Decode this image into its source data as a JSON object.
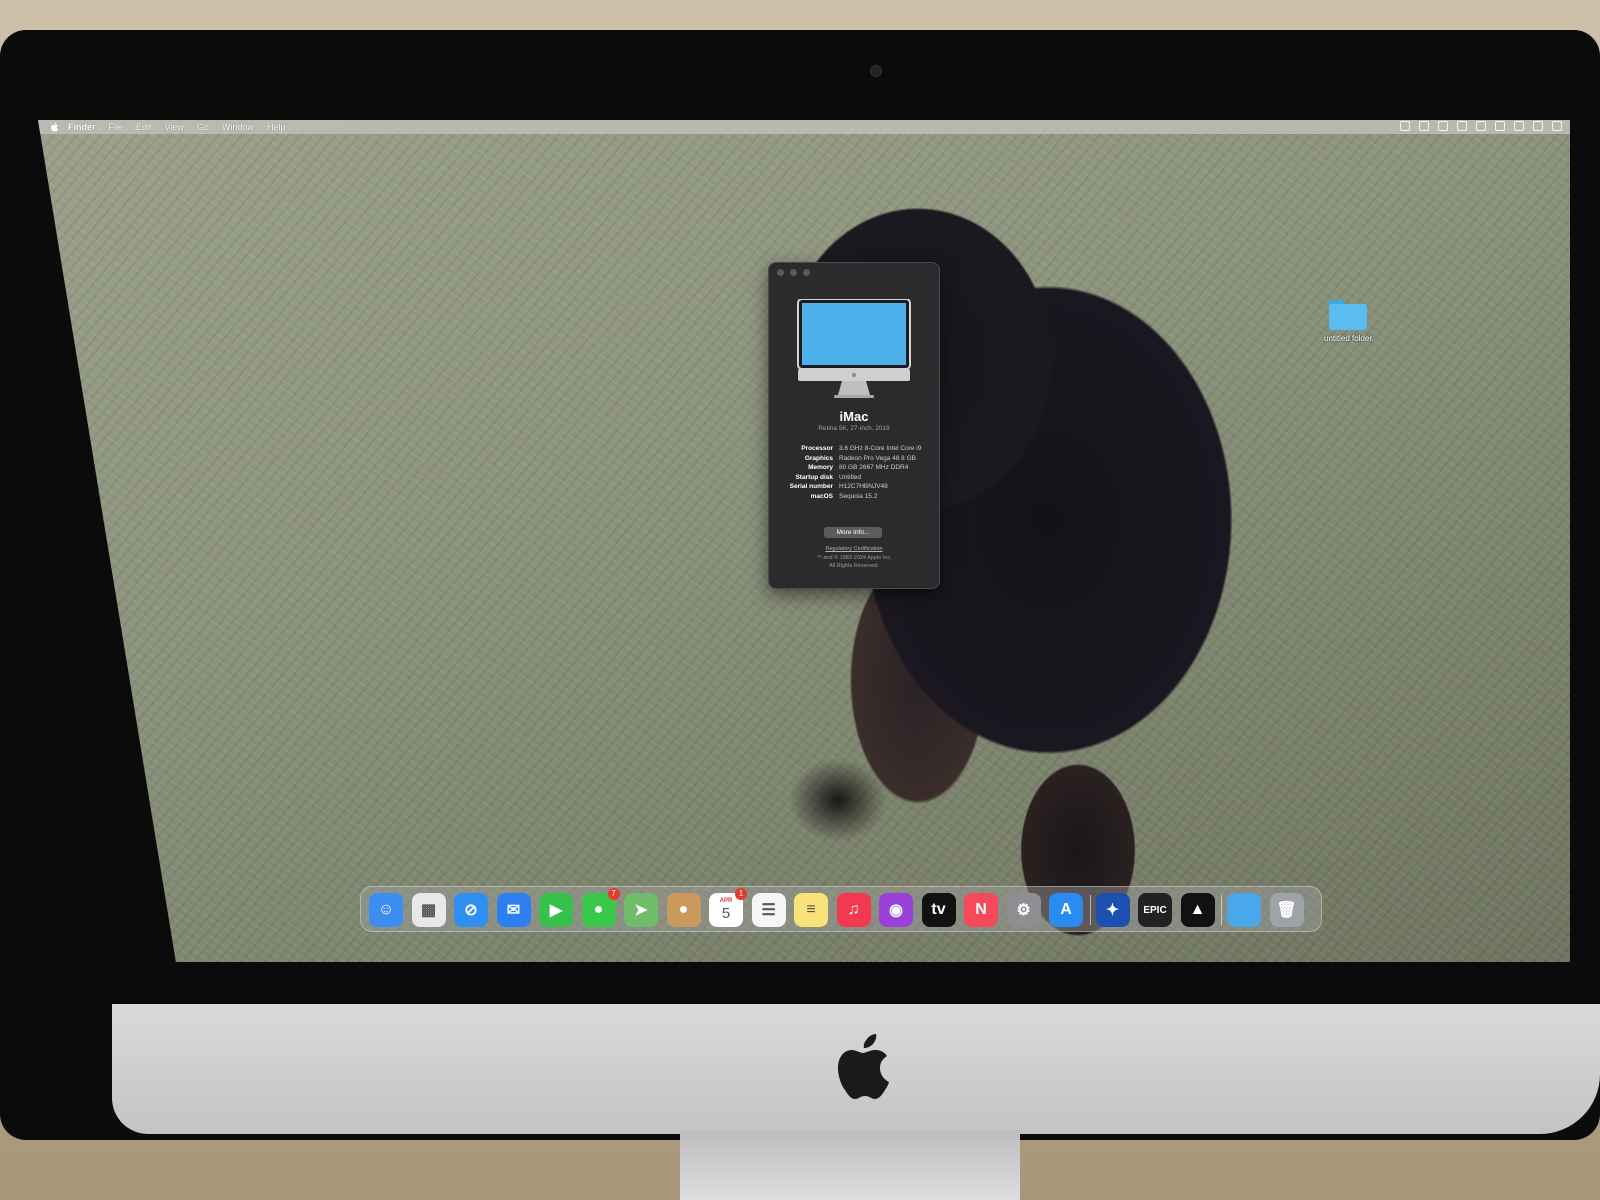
{
  "menubar": {
    "app_name": "Finder",
    "items": [
      "File",
      "Edit",
      "View",
      "Go",
      "Window",
      "Help"
    ],
    "status_icons": [
      "bluetooth-icon",
      "battery-icon",
      "display-icon",
      "volume-icon",
      "wifi-icon",
      "user-icon",
      "spotlight-icon",
      "control-center-icon",
      "siri-icon"
    ]
  },
  "desktop": {
    "folder_label": "untitled folder"
  },
  "about_window": {
    "model": "iMac",
    "subtitle": "Retina 5K, 27-inch, 2019",
    "specs": [
      {
        "key": "Processor",
        "value": "3.6 GHz 8-Core Intel Core i9"
      },
      {
        "key": "Graphics",
        "value": "Radeon Pro Vega 48 8 GB"
      },
      {
        "key": "Memory",
        "value": "80 GB 2667 MHz DDR4"
      },
      {
        "key": "Startup disk",
        "value": "Untitled"
      },
      {
        "key": "Serial number",
        "value": "H12C7HBNJV48"
      },
      {
        "key": "macOS",
        "value": "Sequoia 15.2"
      }
    ],
    "more_info_button": "More Info...",
    "regulatory_link": "Regulatory Certification",
    "copyright_line1": "™ and © 1983-2024 Apple Inc.",
    "copyright_line2": "All Rights Reserved."
  },
  "dock": {
    "apps": [
      {
        "name": "Finder",
        "icon": "finder-icon",
        "color": "#3b8ef0",
        "glyph": "☺"
      },
      {
        "name": "Launchpad",
        "icon": "launchpad-icon",
        "color": "#e8e8ea",
        "glyph": "▦"
      },
      {
        "name": "Safari",
        "icon": "safari-icon",
        "color": "#2f8ef2",
        "glyph": "⊘"
      },
      {
        "name": "Mail",
        "icon": "mail-icon",
        "color": "#2c7ff0",
        "glyph": "✉"
      },
      {
        "name": "FaceTime",
        "icon": "facetime-icon",
        "color": "#37c14a",
        "glyph": "▶"
      },
      {
        "name": "Messages",
        "icon": "messages-icon",
        "color": "#39c84a",
        "glyph": "●",
        "badge": "7"
      },
      {
        "name": "Maps",
        "icon": "maps-icon",
        "color": "#6fbd6a",
        "glyph": "➤"
      },
      {
        "name": "Contacts",
        "icon": "contacts-icon",
        "color": "#c99a5c",
        "glyph": "●"
      },
      {
        "name": "Calendar",
        "icon": "calendar-icon",
        "color": "#ffffff",
        "glyph": "5",
        "month": "APR",
        "badge": "1"
      },
      {
        "name": "Reminders",
        "icon": "reminders-icon",
        "color": "#f5f5f7",
        "glyph": "☰"
      },
      {
        "name": "Notes",
        "icon": "notes-icon",
        "color": "#f8e27a",
        "glyph": "≡"
      },
      {
        "name": "Music",
        "icon": "music-icon",
        "color": "#f3394f",
        "glyph": "♫"
      },
      {
        "name": "Podcasts",
        "icon": "podcasts-icon",
        "color": "#9a42d8",
        "glyph": "◉"
      },
      {
        "name": "TV",
        "icon": "appletv-icon",
        "color": "#111111",
        "glyph": "tv"
      },
      {
        "name": "News",
        "icon": "news-icon",
        "color": "#f64a5a",
        "glyph": "N"
      },
      {
        "name": "System Settings",
        "icon": "system-settings-icon",
        "color": "#8e8e93",
        "glyph": "⚙"
      },
      {
        "name": "App Store",
        "icon": "app-store-icon",
        "color": "#2a8cf3",
        "glyph": "A"
      },
      {
        "name": "Battle.net",
        "icon": "battlenet-icon",
        "color": "#1c4fb0",
        "glyph": "✦"
      },
      {
        "name": "Epic Games",
        "icon": "epic-games-icon",
        "color": "#222222",
        "glyph": "EPIC"
      },
      {
        "name": "CurseForge",
        "icon": "curseforge-icon",
        "color": "#111111",
        "glyph": "▲"
      },
      {
        "name": "Downloads",
        "icon": "downloads-folder-icon",
        "color": "#4aa8ea",
        "glyph": ""
      },
      {
        "name": "Trash",
        "icon": "trash-icon",
        "color": "#9fa3a8",
        "glyph": "🗑"
      }
    ]
  }
}
